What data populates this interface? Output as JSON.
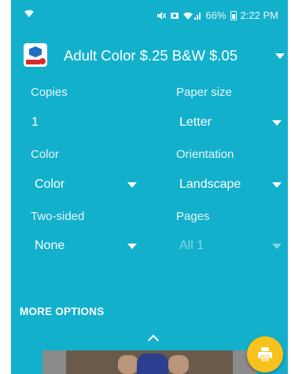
{
  "status_bar": {
    "battery_percent": "66%",
    "time": "2:22 PM"
  },
  "printer": {
    "name": "Adult Color $.25 B&W $.05"
  },
  "settings": {
    "copies": {
      "label": "Copies",
      "value": "1"
    },
    "paper_size": {
      "label": "Paper size",
      "value": "Letter"
    },
    "color": {
      "label": "Color",
      "value": "Color"
    },
    "orientation": {
      "label": "Orientation",
      "value": "Landscape"
    },
    "two_sided": {
      "label": "Two-sided",
      "value": "None"
    },
    "pages": {
      "label": "Pages",
      "value": "All 1"
    }
  },
  "more_options_label": "MORE OPTIONS",
  "icons": {
    "wifi_left": "wifi-icon",
    "mute": "mute-icon",
    "notification": "notification-icon",
    "wifi_signal": "wifi-signal-icon",
    "battery": "battery-icon",
    "expand": "chevron-up-icon",
    "print": "print-icon"
  },
  "colors": {
    "background": "#13b0cc",
    "fab": "#f8c21d"
  }
}
